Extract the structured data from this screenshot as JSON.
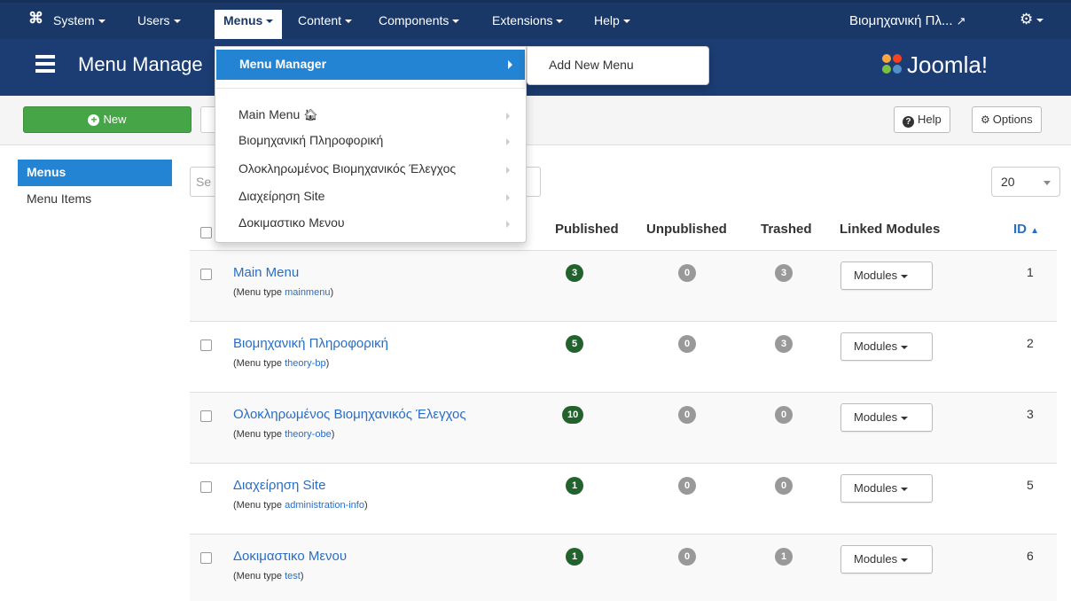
{
  "topnav": {
    "items": [
      {
        "label": "System"
      },
      {
        "label": "Users"
      },
      {
        "label": "Menus"
      },
      {
        "label": "Content"
      },
      {
        "label": "Components"
      },
      {
        "label": "Extensions"
      },
      {
        "label": "Help"
      }
    ],
    "site_label": "Βιομηχανική Πλ...",
    "active_item": "Menus"
  },
  "header": {
    "title": "Menu Manage",
    "brand": "Joomla!"
  },
  "toolbar": {
    "new_label": "New",
    "help_label": "Help",
    "options_label": "Options"
  },
  "sidebar": {
    "items": [
      {
        "label": "Menus",
        "active": true
      },
      {
        "label": "Menu Items",
        "active": false
      }
    ]
  },
  "filters": {
    "search_placeholder": "Se",
    "limit": "20"
  },
  "table": {
    "headers": {
      "published": "Published",
      "unpublished": "Unpublished",
      "trashed": "Trashed",
      "linked_modules": "Linked Modules",
      "id": "ID"
    },
    "menu_type_prefix": "(Menu type ",
    "menu_type_suffix": ")",
    "modules_label": "Modules",
    "rows": [
      {
        "title": "Main Menu",
        "menutype": "mainmenu",
        "published": "3",
        "unpublished": "0",
        "trashed": "3",
        "id": "1"
      },
      {
        "title": "Βιομηχανική Πληροφορική",
        "menutype": "theory-bp",
        "published": "5",
        "unpublished": "0",
        "trashed": "3",
        "id": "2"
      },
      {
        "title": "Ολοκληρωμένος Βιομηχανικός Έλεγχος",
        "menutype": "theory-obe",
        "published": "10",
        "unpublished": "0",
        "trashed": "0",
        "id": "3"
      },
      {
        "title": "Διαχείρηση Site",
        "menutype": "administration-info",
        "published": "1",
        "unpublished": "0",
        "trashed": "0",
        "id": "5"
      },
      {
        "title": "Δοκιμαστικο Μενου",
        "menutype": "test",
        "published": "1",
        "unpublished": "0",
        "trashed": "1",
        "id": "6"
      }
    ]
  },
  "menus_dropdown": {
    "header": "Menu Manager",
    "items": [
      {
        "label": "Main Menu"
      },
      {
        "label": "Βιομηχανική Πληροφορική"
      },
      {
        "label": "Ολοκληρωμένος Βιομηχανικός Έλεγχος"
      },
      {
        "label": "Διαχείρηση Site"
      },
      {
        "label": "Δοκιμαστικο Μενου"
      }
    ],
    "submenu_item": "Add New Menu"
  },
  "colors": {
    "navbar": "#1a3867",
    "header": "#1c3d73",
    "active_blue": "#2384d3",
    "link": "#2a6ec3",
    "published_badge": "#22632d",
    "neutral_badge": "#999999",
    "new_button": "#46a546"
  }
}
